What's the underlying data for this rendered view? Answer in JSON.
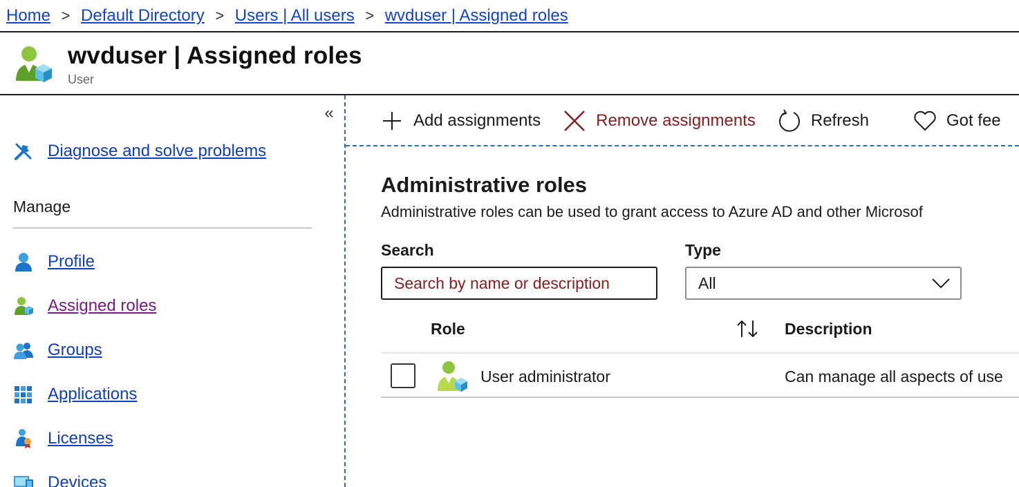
{
  "breadcrumb": {
    "items": [
      "Home",
      "Default Directory",
      "Users | All users",
      "wvduser | Assigned roles"
    ],
    "separator": ">"
  },
  "header": {
    "title": "wvduser | Assigned roles",
    "subtitle": "User",
    "icon": "user-role-icon"
  },
  "sidebar": {
    "collapse_label": "«",
    "diagnose_label": "Diagnose and solve problems",
    "section_label": "Manage",
    "items": [
      {
        "label": "Profile",
        "icon": "profile-icon"
      },
      {
        "label": "Assigned roles",
        "icon": "assigned-roles-icon"
      },
      {
        "label": "Groups",
        "icon": "groups-icon"
      },
      {
        "label": "Applications",
        "icon": "applications-icon"
      },
      {
        "label": "Licenses",
        "icon": "licenses-icon"
      },
      {
        "label": "Devices",
        "icon": "devices-icon"
      }
    ]
  },
  "toolbar": {
    "add_label": "Add assignments",
    "remove_label": "Remove assignments",
    "refresh_label": "Refresh",
    "feedback_label": "Got fee"
  },
  "main": {
    "section_title": "Administrative roles",
    "section_desc": "Administrative roles can be used to grant access to Azure AD and other Microsof",
    "search_label": "Search",
    "search_placeholder": "Search by name or description",
    "type_label": "Type",
    "type_value": "All"
  },
  "table": {
    "columns": [
      "Role",
      "Description"
    ],
    "rows": [
      {
        "role": "User administrator",
        "description": "Can manage all aspects of use"
      }
    ]
  },
  "colors": {
    "link": "#1144d6",
    "visited_link": "#7a1a8a",
    "remove_red": "#8a1c1c",
    "focus_dash": "#2b6cb8"
  }
}
